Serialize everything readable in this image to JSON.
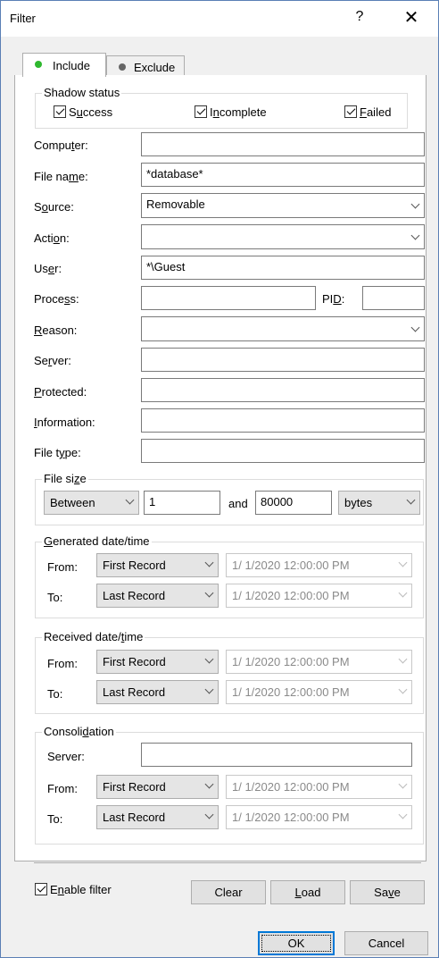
{
  "window": {
    "title": "Filter",
    "help_label": "?",
    "close_label": "✕"
  },
  "tabs": {
    "include": "Include",
    "exclude": "Exclude",
    "include_dot": "#2fb82f",
    "exclude_dot": "#666666"
  },
  "shadow_status": {
    "label": "Shadow status",
    "success": "Success",
    "incomplete": "Incomplete",
    "failed": "Failed",
    "success_checked": true,
    "incomplete_checked": true,
    "failed_checked": true
  },
  "fields": {
    "computer": {
      "label": "Computer:",
      "value": ""
    },
    "file_name": {
      "label": "File name:",
      "value": "*database*"
    },
    "source": {
      "label": "Source:",
      "value": "Removable"
    },
    "action": {
      "label": "Action:",
      "value": ""
    },
    "user": {
      "label": "User:",
      "value": "*\\Guest"
    },
    "process": {
      "label": "Process:",
      "value": ""
    },
    "pid": {
      "label": "PID:",
      "value": ""
    },
    "reason": {
      "label": "Reason:",
      "value": ""
    },
    "server": {
      "label": "Server:",
      "value": ""
    },
    "protected": {
      "label": "Protected:",
      "value": ""
    },
    "information": {
      "label": "Information:",
      "value": ""
    },
    "file_type": {
      "label": "File type:",
      "value": ""
    }
  },
  "file_size": {
    "label": "File size",
    "mode": "Between",
    "min": "1",
    "and_label": "and",
    "max": "80000",
    "unit": "bytes"
  },
  "generated": {
    "label": "Generated date/time",
    "from_label": "From:",
    "from_select": "First Record",
    "from_date": "1/  1/2020 12:00:00 PM",
    "to_label": "To:",
    "to_select": "Last Record",
    "to_date": "1/  1/2020 12:00:00 PM"
  },
  "received": {
    "label": "Received date/time",
    "from_label": "From:",
    "from_select": "First Record",
    "from_date": "1/  1/2020 12:00:00 PM",
    "to_label": "To:",
    "to_select": "Last Record",
    "to_date": "1/  1/2020 12:00:00 PM"
  },
  "consolidation": {
    "label": "Consolidation",
    "server_label": "Server:",
    "server_value": "",
    "from_label": "From:",
    "from_select": "First Record",
    "from_date": "1/  1/2020 12:00:00 PM",
    "to_label": "To:",
    "to_select": "Last Record",
    "to_date": "1/  1/2020 12:00:00 PM"
  },
  "footer": {
    "enable_filter": "Enable filter",
    "enable_checked": true,
    "clear": "Clear",
    "load": "Load",
    "save": "Save",
    "ok": "OK",
    "cancel": "Cancel"
  }
}
